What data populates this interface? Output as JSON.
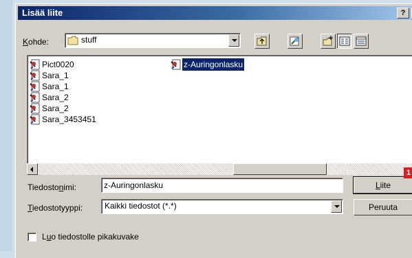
{
  "dialog": {
    "title": "Lisää liite",
    "help_button": "?"
  },
  "location": {
    "label_prefix": "K",
    "label_rest": "ohde:",
    "value": "stuff"
  },
  "toolbar": {
    "icons": [
      "up-one-level-icon",
      "browse-web-icon",
      "new-folder-icon",
      "list-view-icon",
      "details-view-icon"
    ]
  },
  "files": {
    "column_left": [
      {
        "name": "Pict0020"
      },
      {
        "name": "Sara_1"
      },
      {
        "name": "Sara_1"
      },
      {
        "name": "Sara_2"
      },
      {
        "name": "Sara_2"
      },
      {
        "name": "Sara_3453451"
      }
    ],
    "column_right": [
      {
        "name": "z-Auringonlasku",
        "selected": true
      }
    ]
  },
  "filename": {
    "label_before": "Tiedosto",
    "label_underlined": "n",
    "label_after": "imi:",
    "value": "z-Auringonlasku"
  },
  "filetype": {
    "label_underlined": "T",
    "label_rest": "iedostotyyppi:",
    "value": "Kaikki tiedostot (*.*)"
  },
  "buttons": {
    "attach_underlined": "L",
    "attach_rest": "iite",
    "cancel": "Peruuta"
  },
  "badge": "1",
  "shortcut": {
    "label_before": "L",
    "label_underlined": "u",
    "label_after": "o tiedostolle pikakuvake",
    "checked": false
  },
  "colors": {
    "title_start": "#0a246a",
    "title_end": "#a6caf0",
    "selection": "#0a246a",
    "badge": "#d81e1e",
    "face": "#d4d0c8"
  }
}
